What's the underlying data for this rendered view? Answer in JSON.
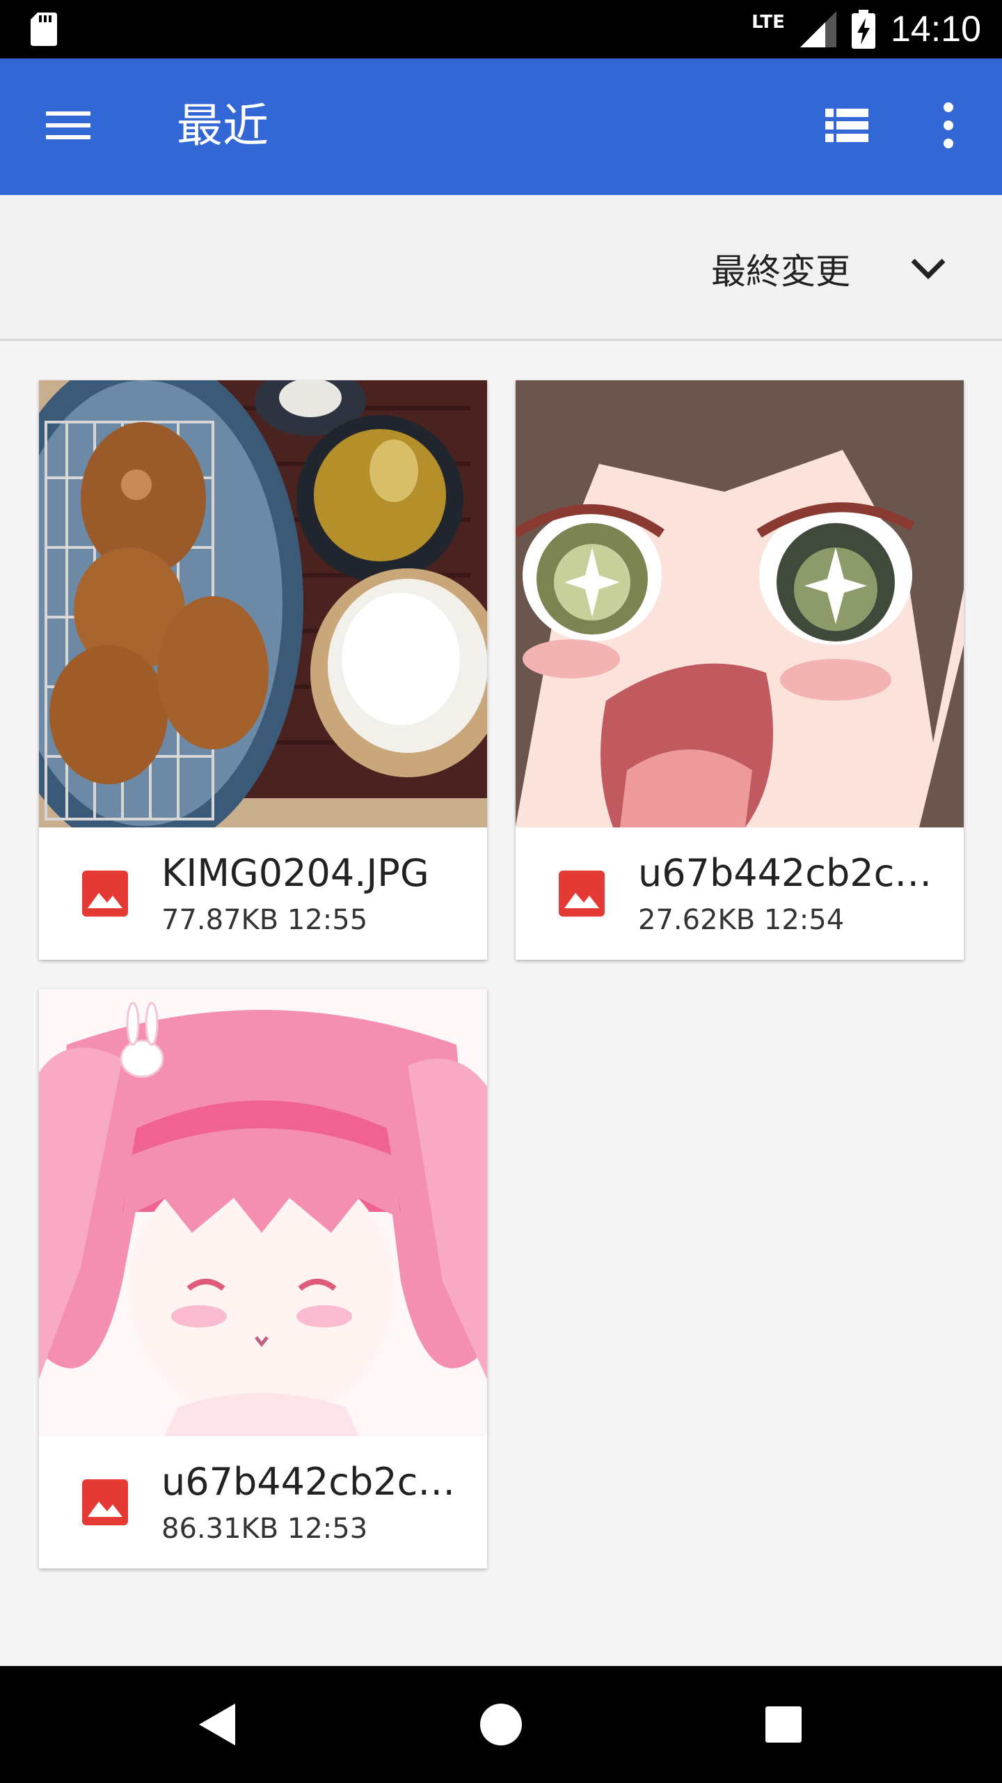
{
  "status_bar": {
    "network": "LTE",
    "time": "14:10"
  },
  "app_bar": {
    "title": "最近",
    "menu_icon": "hamburger-menu-icon",
    "list_view_icon": "list-view-icon",
    "more_icon": "more-vert-icon"
  },
  "sort": {
    "label": "最終変更",
    "icon": "chevron-down-icon"
  },
  "files": [
    {
      "name": "KIMG0204.JPG",
      "info": "77.87KB 12:55",
      "icon": "image-file-icon"
    },
    {
      "name": "u67b442cb2cb…",
      "info": "27.62KB 12:54",
      "icon": "image-file-icon"
    },
    {
      "name": "u67b442cb2cb…",
      "info": "86.31KB 12:53",
      "icon": "image-file-icon"
    }
  ],
  "colors": {
    "app_bar": "#3367d6",
    "file_icon": "#e53935",
    "background": "#f5f5f5"
  }
}
